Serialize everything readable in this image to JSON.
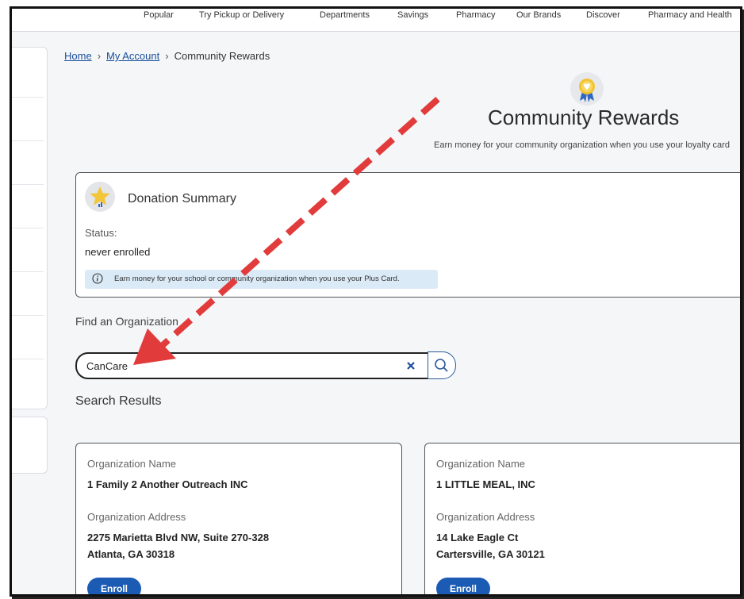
{
  "topnav": {
    "items": [
      "Popular",
      "Try Pickup or Delivery",
      "Departments",
      "Savings",
      "Pharmacy",
      "Our Brands",
      "Discover",
      "Pharmacy and Health"
    ]
  },
  "breadcrumb": {
    "home": "Home",
    "my_account": "My Account",
    "current": "Community Rewards",
    "separator": "›"
  },
  "page": {
    "title": "Community Rewards",
    "subtitle": "Earn money for your community organization when you use your loyalty card"
  },
  "summary": {
    "title": "Donation Summary",
    "status_label": "Status:",
    "status_value": "never enrolled",
    "info_text": "Earn money for your school or community organization when you use your Plus Card."
  },
  "search": {
    "label": "Find an Organization",
    "value": "CanCare",
    "clear_icon": "close-icon",
    "search_icon": "search-icon"
  },
  "results": {
    "title": "Search Results",
    "name_label": "Organization Name",
    "address_label": "Organization Address",
    "enroll_label": "Enroll",
    "items": [
      {
        "name": "1 Family 2 Another Outreach INC",
        "address_line1": "2275 Marietta Blvd NW, Suite 270-328",
        "address_line2": "Atlanta, GA 30318"
      },
      {
        "name": "1 LITTLE MEAL, INC",
        "address_line1": "14 Lake Eagle Ct",
        "address_line2": "Cartersville, GA 30121"
      }
    ]
  },
  "colors": {
    "accent": "#1c5bb4",
    "arrow": "#e23b3b",
    "banner": "#dbeaf7"
  }
}
